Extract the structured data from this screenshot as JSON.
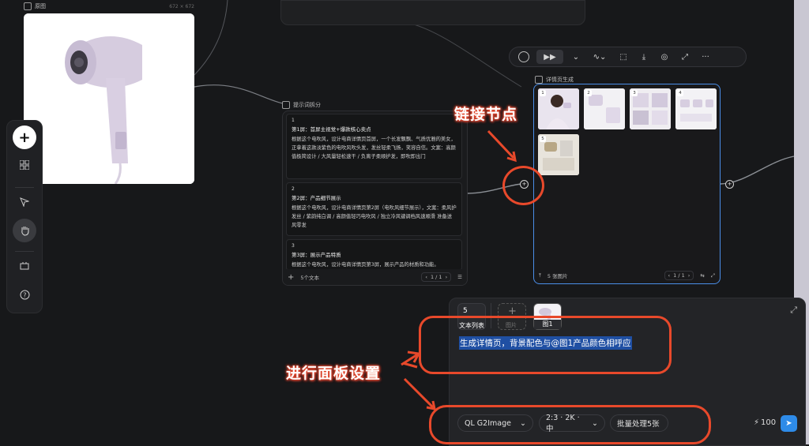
{
  "source_node": {
    "title": "原图",
    "size_label": "672 × 672"
  },
  "toolbar": {
    "add_label": "+",
    "items": [
      "add",
      "grid",
      "select",
      "hand",
      "crop",
      "help"
    ]
  },
  "text_node": {
    "title": "提示词拆分",
    "scenes": [
      {
        "num": "1",
        "head": "第1屏：首屏主视觉+爆款核心卖点",
        "body": "根据这个电吹风，设计电商详情页首屏，一个长发飘飘、气质优雅的美女，正拿着这款淡紫色的电吹风吹头发，发丝轻柔飞扬，笑容自信。文案：高颜值极简设计 / 大风量轻松速干 / 负离子柔顺护发，即吹即出门"
      },
      {
        "num": "2",
        "head": "第2屏：产品细节展示",
        "body": "根据这个电吹风，设计电商详情页第2屏（电吹风细节展示），文案：柔风护发丝 / 紫韵纯白调 / 高颜值轻巧电吹风 / 独立冷风键调档风速顺滑 准备送风零发"
      },
      {
        "num": "3",
        "head": "第3屏：展示产品特质",
        "body": "根据这个电吹风，设计电商详情页第3屏，展示产品的材质和功能。"
      }
    ],
    "footer_count": "5个文本",
    "pager": "1 / 1"
  },
  "image_node": {
    "title": "详情页生成",
    "thumb_indices": [
      "1",
      "2",
      "3",
      "4",
      "5"
    ],
    "footer_count": "5 张图片",
    "pager": "1 / 1"
  },
  "node_toolbar": {
    "items": [
      "circle",
      "run",
      "chevron",
      "link",
      "frame",
      "download",
      "capture",
      "expand",
      "more"
    ]
  },
  "panel": {
    "attachments": [
      {
        "label": "文本列表",
        "badge": "5"
      },
      {
        "label": "图片"
      },
      {
        "label": "图1"
      }
    ],
    "prompt": "生成详情页，背景配色与@图1产品颜色相呼应",
    "model": "QL G2Image",
    "ratio": "2:3 · 2K · 中",
    "batch": "批量处理5张",
    "credits": "100"
  },
  "annotations": {
    "link_node": "链接节点",
    "panel_settings": "进行面板设置"
  },
  "colors": {
    "accent": "#4a8ee8",
    "annotation": "#e8492b",
    "send": "#2e8be8",
    "selection": "#1f4fa3"
  }
}
